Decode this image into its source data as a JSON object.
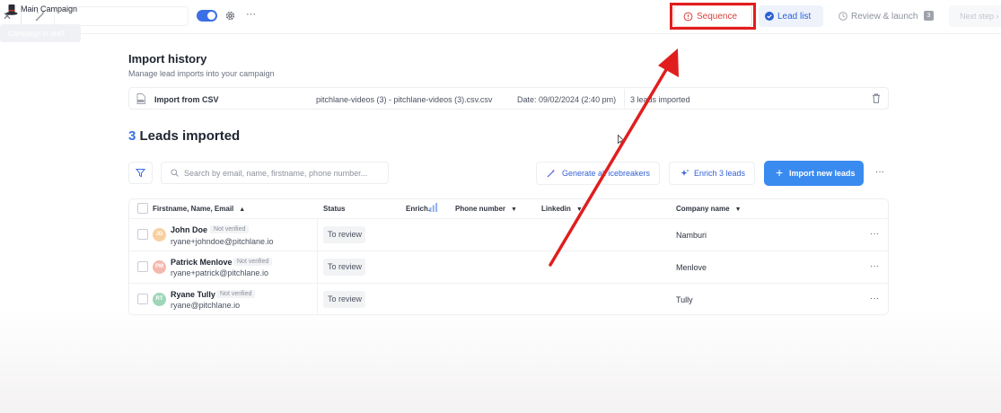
{
  "topbar": {
    "close_icon": "close-icon",
    "campaign_name": "Main Campaign",
    "more": "···",
    "tooltip": "Campaign in draft",
    "steps": {
      "sequence": "Sequence",
      "lead_list": "Lead list",
      "review_launch": "Review & launch",
      "review_badge": "3",
      "next_step": "Next step"
    },
    "colors": {
      "accent": "#3b6fe6",
      "sequence": "#d7413b",
      "annotation": "#e01e1e"
    }
  },
  "import_history": {
    "title": "Import history",
    "subtitle": "Manage lead imports into your campaign",
    "entry": {
      "label": "Import from CSV",
      "file": "pitchlane-videos (3) - pitchlane-videos (3).csv.csv",
      "date": "Date: 09/02/2024 (2:40 pm)",
      "count": "3 leads imported"
    }
  },
  "leads": {
    "count": "3",
    "title": "Leads imported",
    "search_placeholder": "Search by email, name, firstname, phone number...",
    "buttons": {
      "icebreakers": "Generate all icebreakers",
      "enrich": "Enrich 3 leads",
      "import_plus": "+",
      "import": "Import new leads",
      "more": "···"
    },
    "columns": {
      "name": "Firstname, Name, Email",
      "status": "Status",
      "enrich": "Enrich.",
      "phone": "Phone number",
      "linkedin": "Linkedin",
      "company": "Company name",
      "caret": "▲",
      "caret_down": "▼"
    },
    "rows": [
      {
        "initials": "JD",
        "name": "John Doe",
        "badge": "Not verified",
        "email": "ryane+johndoe@pitchlane.io",
        "status": "To review",
        "company": "Namburi",
        "more": "···",
        "color": "#f9cf9f"
      },
      {
        "initials": "PM",
        "name": "Patrick Menlove",
        "badge": "Not verified",
        "email": "ryane+patrick@pitchlane.io",
        "status": "To review",
        "company": "Menlove",
        "more": "···",
        "color": "#f5b8ad"
      },
      {
        "initials": "RT",
        "name": "Ryane Tully",
        "badge": "Not verified",
        "email": "ryane@pitchlane.io",
        "status": "To review",
        "company": "Tully",
        "more": "···",
        "color": "#9fd6b9"
      }
    ]
  }
}
